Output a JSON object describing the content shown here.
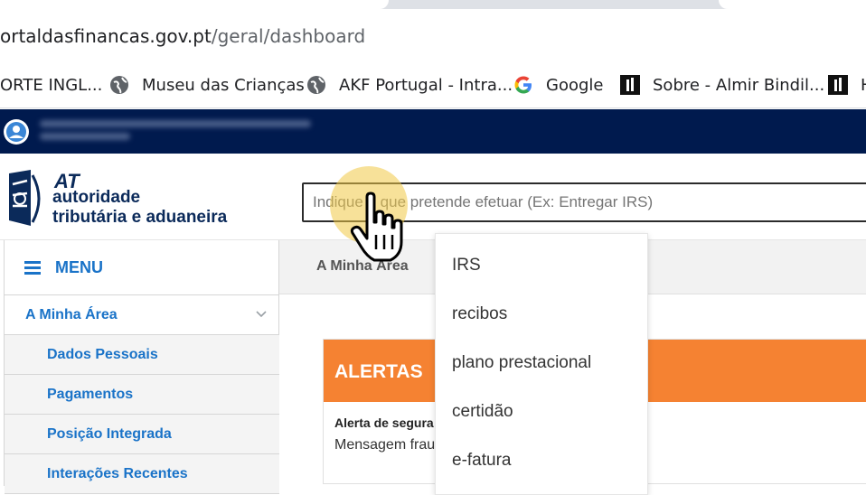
{
  "browser": {
    "url_host": "ortaldasfinancas.gov.pt",
    "url_path": "/geral/dashboard",
    "bookmarks": [
      {
        "label": "ORTE INGL...",
        "icon": "none"
      },
      {
        "label": "Museu das Crianças",
        "icon": "globe-icon"
      },
      {
        "label": "AKF Portugal - Intra...",
        "icon": "globe-icon"
      },
      {
        "label": "Google",
        "icon": "google-icon"
      },
      {
        "label": "Sobre - Almir Bindil...",
        "icon": "site-icon"
      },
      {
        "label": "H",
        "icon": "site-icon"
      }
    ]
  },
  "header": {
    "logo_at": "AT",
    "logo_line1": "autoridade",
    "logo_line2": "tributária e aduaneira",
    "search_placeholder": "Indique o que pretende efetuar (Ex: Entregar IRS)"
  },
  "sidebar": {
    "menu_label": "MENU",
    "items": [
      {
        "label": "A Minha Área",
        "level": "top"
      },
      {
        "label": "Dados Pessoais",
        "level": "sub"
      },
      {
        "label": "Pagamentos",
        "level": "sub"
      },
      {
        "label": "Posição Integrada",
        "level": "sub"
      },
      {
        "label": "Interações Recentes",
        "level": "sub"
      }
    ]
  },
  "main": {
    "tab_label": "A Minha Área",
    "alerts": {
      "title": "ALERTAS",
      "item_title": "Alerta de segura",
      "item_text": "Mensagem frau"
    }
  },
  "suggestions": [
    "IRS",
    "recibos",
    "plano prestacional",
    "certidão",
    "e-fatura"
  ],
  "colors": {
    "topbar": "#001a4e",
    "brand_blue": "#1a73c8",
    "alert_orange": "#f58232"
  }
}
